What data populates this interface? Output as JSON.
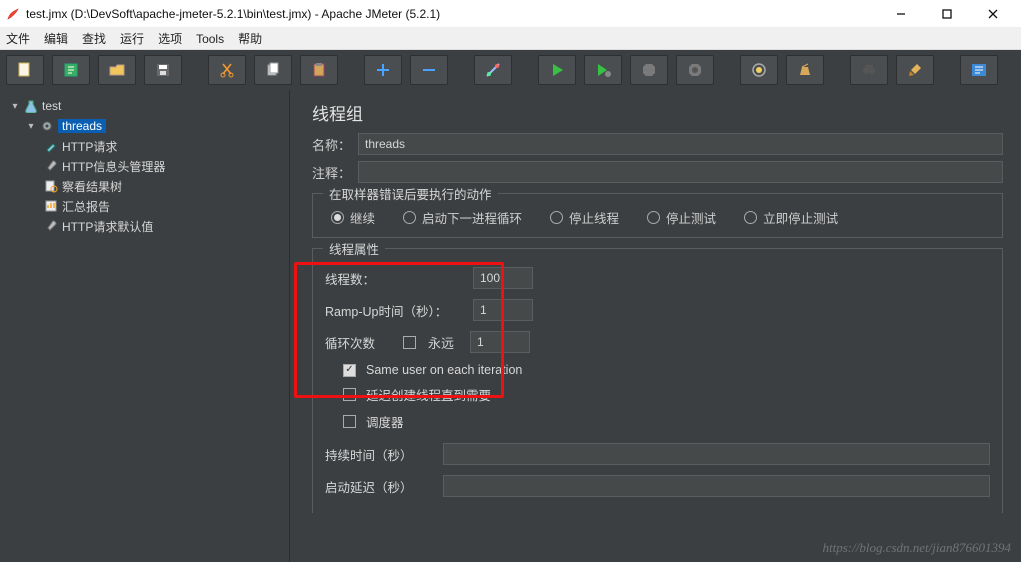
{
  "window": {
    "title": "test.jmx (D:\\DevSoft\\apache-jmeter-5.2.1\\bin\\test.jmx) - Apache JMeter (5.2.1)"
  },
  "menu": {
    "file": "文件",
    "edit": "编辑",
    "search": "查找",
    "run": "运行",
    "options": "选项",
    "tools": "Tools",
    "help": "帮助"
  },
  "toolbar_icons": [
    "new",
    "templates",
    "open",
    "save",
    "cut",
    "copy",
    "paste",
    "add",
    "remove",
    "wand",
    "start",
    "start-no",
    "stop",
    "shutdown",
    "config",
    "clear",
    "search",
    "broom",
    "fn"
  ],
  "tree": {
    "root": {
      "label": "test"
    },
    "threads": {
      "label": "threads"
    },
    "children": [
      {
        "label": "HTTP请求"
      },
      {
        "label": "HTTP信息头管理器"
      },
      {
        "label": "察看结果树"
      },
      {
        "label": "汇总报告"
      },
      {
        "label": "HTTP请求默认值"
      }
    ]
  },
  "panel": {
    "title": "线程组",
    "name_label": "名称：",
    "name_value": "threads",
    "comments_label": "注释：",
    "comments_value": "",
    "action_legend": "在取样器错误后要执行的动作",
    "radios": [
      "继续",
      "启动下一进程循环",
      "停止线程",
      "停止测试",
      "立即停止测试"
    ],
    "radio_selected": 0,
    "props_legend": "线程属性",
    "threads_label": "线程数：",
    "threads_value": "100",
    "ramp_label": "Ramp-Up时间（秒）：",
    "ramp_value": "1",
    "loop_label": "循环次数",
    "loop_forever": "永远",
    "loop_value": "1",
    "same_user": "Same user on each iteration",
    "delay_create": "延迟创建线程直到需要",
    "scheduler": "调度器",
    "duration_label": "持续时间（秒）",
    "delay_label": "启动延迟（秒）"
  },
  "watermark": "https://blog.csdn.net/jian876601394"
}
